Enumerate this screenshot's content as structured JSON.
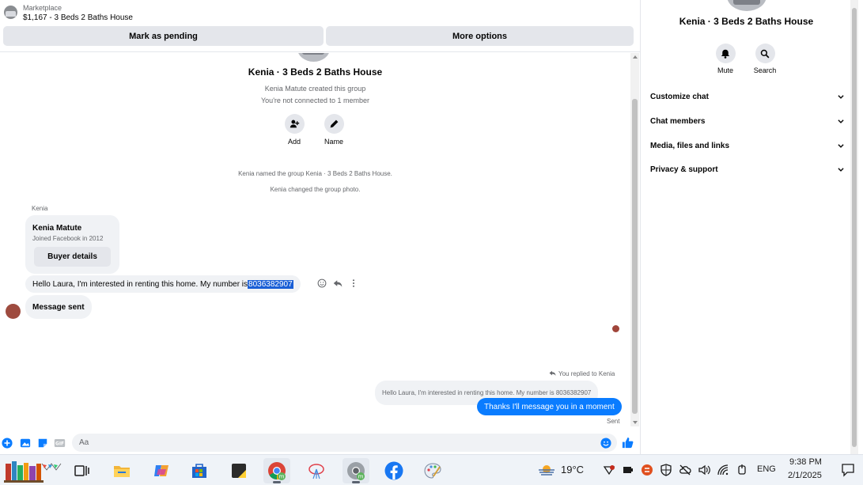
{
  "listing": {
    "source": "Marketplace",
    "title": "$1,167 - 3 Beds 2 Baths House"
  },
  "top_buttons": {
    "pending": "Mark as pending",
    "more": "More options"
  },
  "group": {
    "title": "Kenia · 3 Beds 2 Baths House",
    "created_by": "Kenia Matute created this group",
    "connection": "You're not connected to 1 member",
    "add_label": "Add",
    "name_label": "Name"
  },
  "system_messages": {
    "named": "Kenia named the group Kenia · 3 Beds 2 Baths House.",
    "photo": "Kenia changed the group photo."
  },
  "thread": {
    "sender_short": "Kenia",
    "profile_name": "Kenia Matute",
    "profile_joined": "Joined Facebook in 2012",
    "buyer_details_label": "Buyer details",
    "msg1_text": "Hello Laura, I'm interested in renting this home. My number is ",
    "msg1_selected": "8036382907",
    "msg2_text": "Message sent",
    "reply_note": "You replied to Kenia",
    "quoted_text": "Hello Laura, I'm interested in renting this home. My number is 8036382907",
    "reply_text": "Thanks I'll message you in a moment",
    "reply_status": "Sent"
  },
  "composer": {
    "placeholder": "Aa"
  },
  "info_panel": {
    "title": "Kenia · 3 Beds 2 Baths House",
    "mute_label": "Mute",
    "search_label": "Search",
    "sections": [
      "Customize chat",
      "Chat members",
      "Media, files and links",
      "Privacy & support"
    ]
  },
  "taskbar": {
    "weather": "19°C",
    "language": "ENG",
    "time": "9:38 PM",
    "date": "2/1/2025"
  },
  "colors": {
    "messenger_blue": "#0a7cff",
    "bubble_gray": "#f0f2f5",
    "selection": "#1a5fd6"
  }
}
